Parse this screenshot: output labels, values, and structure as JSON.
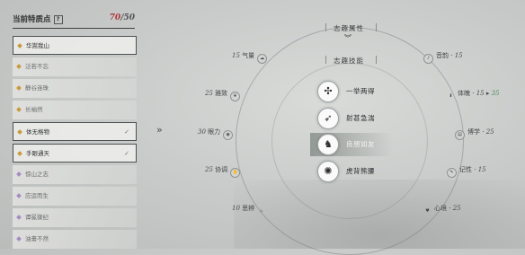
{
  "panel": {
    "title": "当前特质点",
    "help": "?",
    "points_current": "70",
    "points_max": "/50"
  },
  "traits": [
    {
      "label": "华嵩我山",
      "selected": true,
      "checked": false,
      "color": "gold"
    },
    {
      "label": "泛若不忘",
      "selected": false,
      "checked": false,
      "color": "gold"
    },
    {
      "label": "静谷连珠",
      "selected": false,
      "checked": false,
      "color": "gold"
    },
    {
      "label": "长袖然",
      "selected": false,
      "checked": false,
      "color": "gold"
    },
    {
      "label": "体无格物",
      "selected": true,
      "checked": true,
      "color": "gold"
    },
    {
      "label": "手眼通天",
      "selected": true,
      "checked": true,
      "color": "gold"
    },
    {
      "label": "惊山之志",
      "selected": false,
      "checked": false,
      "color": "purple"
    },
    {
      "label": "应运而生",
      "selected": false,
      "checked": false,
      "color": "purple"
    },
    {
      "label": "谭冕骤纪",
      "selected": false,
      "checked": false,
      "color": "purple"
    },
    {
      "label": "油畫不然",
      "selected": false,
      "checked": false,
      "color": "purple"
    }
  ],
  "arrow_glyph": "»",
  "sections": {
    "attributes": "志趣属性",
    "skills": "志趣技能",
    "chevron": "︾"
  },
  "stats": {
    "qiliang": {
      "value": "15",
      "label": "气量",
      "icon": "cloud-icon"
    },
    "yinyun": {
      "label": "音韵",
      "value": "15",
      "icon": "music-icon"
    },
    "shouzhi": {
      "value": "25",
      "label": "雅致",
      "icon": "leaf-icon"
    },
    "tipo": {
      "label": "体魄",
      "value": "15",
      "arrow": "▸",
      "new_value": "35",
      "icon": "body-icon"
    },
    "yanli": {
      "value": "30",
      "label": "眼力",
      "icon": "eye-icon"
    },
    "boxue": {
      "label": "博学",
      "value": "25",
      "icon": "book-icon"
    },
    "xietiao": {
      "value": "25",
      "label": "协调",
      "icon": "hands-icon"
    },
    "jixing": {
      "label": "记性",
      "value": "15",
      "icon": "scroll-icon"
    },
    "sibian": {
      "value": "10",
      "label": "思辨",
      "icon": "flame-icon"
    },
    "xinjing": {
      "label": "心境",
      "value": "25",
      "icon": "heart-icon"
    }
  },
  "skills": [
    {
      "name": "一举两得",
      "icon": "double-strike-icon",
      "glyph": "✣",
      "highlighted": false
    },
    {
      "name": "射甚急湍",
      "icon": "arrow-burst-icon",
      "glyph": "➶",
      "highlighted": false
    },
    {
      "name": "良朋如友",
      "icon": "companions-icon",
      "glyph": "♞",
      "highlighted": true
    },
    {
      "name": "虎背熊腰",
      "icon": "tiger-icon",
      "glyph": "✺",
      "highlighted": false
    }
  ]
}
